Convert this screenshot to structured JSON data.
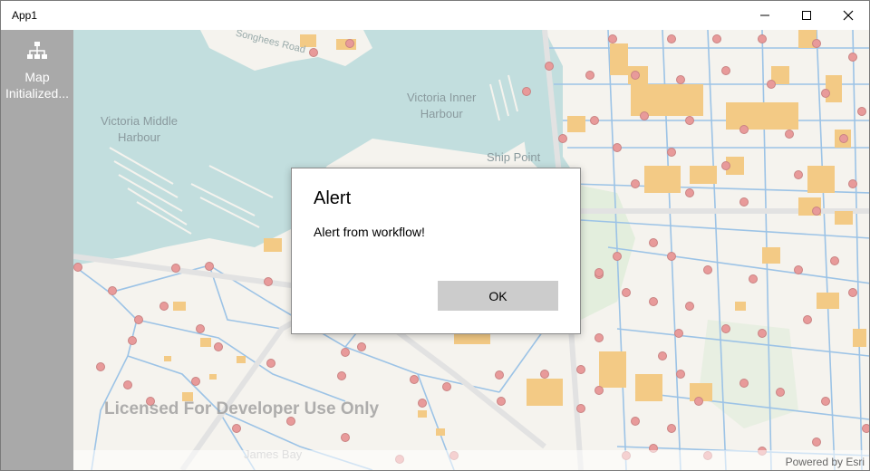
{
  "window": {
    "title": "App1",
    "minimize_label": "Minimize",
    "maximize_label": "Maximize",
    "close_label": "Close"
  },
  "sidebar": {
    "item_label": "Map\nInitialized..."
  },
  "map": {
    "labels": {
      "victoria_middle": "Victoria Middle\nHarbour",
      "victoria_inner": "Victoria Inner\nHarbour",
      "ship_point": "Ship Point",
      "songhees_road": "Songhees Road",
      "james_bay": "James Bay"
    },
    "watermark": "Licensed For Developer Use Only",
    "attribution": "Powered by Esri"
  },
  "dialog": {
    "title": "Alert",
    "message": "Alert from workflow!",
    "ok_label": "OK"
  },
  "colors": {
    "water": "#c2dede",
    "land": "#f5f3ee",
    "building": "#f3ca85",
    "street": "#9cc3e6",
    "node": "#e89a9a",
    "sidebar": "#a9a9a9"
  }
}
